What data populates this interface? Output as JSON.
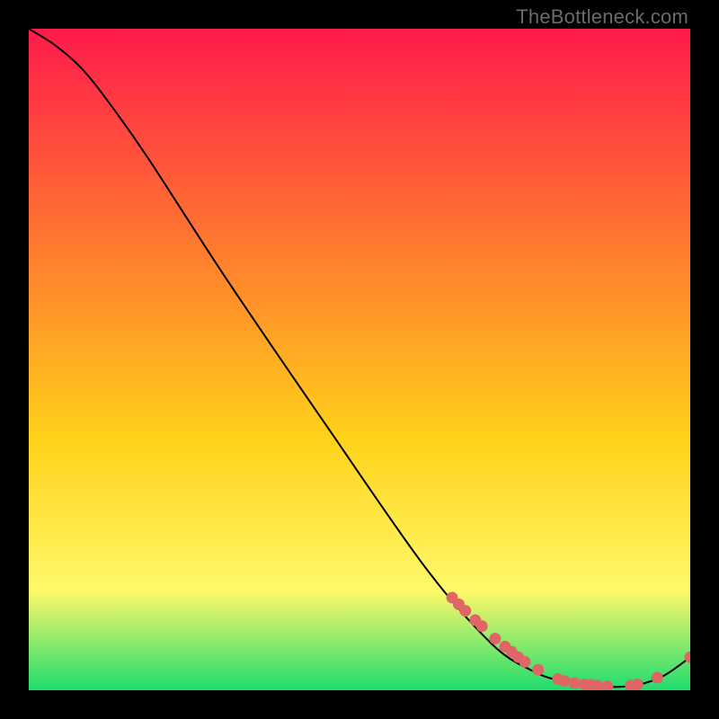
{
  "watermark": "TheBottleneck.com",
  "colors": {
    "gradient_top": "#ff1a4b",
    "gradient_mid1": "#ff7a2f",
    "gradient_mid2": "#ffd21a",
    "gradient_mid3": "#fff96a",
    "gradient_bottom": "#1fdc6e",
    "curve": "#000000",
    "marker_fill": "#e06666",
    "marker_stroke": "#c24d4d"
  },
  "chart_data": {
    "type": "line",
    "title": "",
    "xlabel": "",
    "ylabel": "",
    "xlim": [
      0,
      100
    ],
    "ylim": [
      0,
      100
    ],
    "curve": {
      "x": [
        0,
        4,
        8,
        12,
        18,
        30,
        45,
        60,
        70,
        76,
        80,
        84,
        88,
        92,
        96,
        100
      ],
      "y": [
        100,
        97.5,
        94,
        89,
        80.5,
        62,
        40,
        18.5,
        7,
        3,
        1.5,
        0.8,
        0.5,
        0.8,
        2.2,
        5
      ]
    },
    "markers": [
      {
        "x": 64,
        "y": 14.0
      },
      {
        "x": 65,
        "y": 13.0
      },
      {
        "x": 66,
        "y": 12.0
      },
      {
        "x": 67.5,
        "y": 10.6
      },
      {
        "x": 68.5,
        "y": 9.7
      },
      {
        "x": 70.5,
        "y": 7.8
      },
      {
        "x": 72,
        "y": 6.6
      },
      {
        "x": 73,
        "y": 5.8
      },
      {
        "x": 74,
        "y": 5.0
      },
      {
        "x": 75,
        "y": 4.3
      },
      {
        "x": 77,
        "y": 3.1
      },
      {
        "x": 80,
        "y": 1.7
      },
      {
        "x": 81,
        "y": 1.4
      },
      {
        "x": 82.5,
        "y": 1.1
      },
      {
        "x": 84,
        "y": 0.9
      },
      {
        "x": 85,
        "y": 0.8
      },
      {
        "x": 86,
        "y": 0.7
      },
      {
        "x": 87.5,
        "y": 0.6
      },
      {
        "x": 91,
        "y": 0.7
      },
      {
        "x": 92,
        "y": 0.9
      },
      {
        "x": 95,
        "y": 1.9
      },
      {
        "x": 100,
        "y": 5.0
      }
    ]
  }
}
